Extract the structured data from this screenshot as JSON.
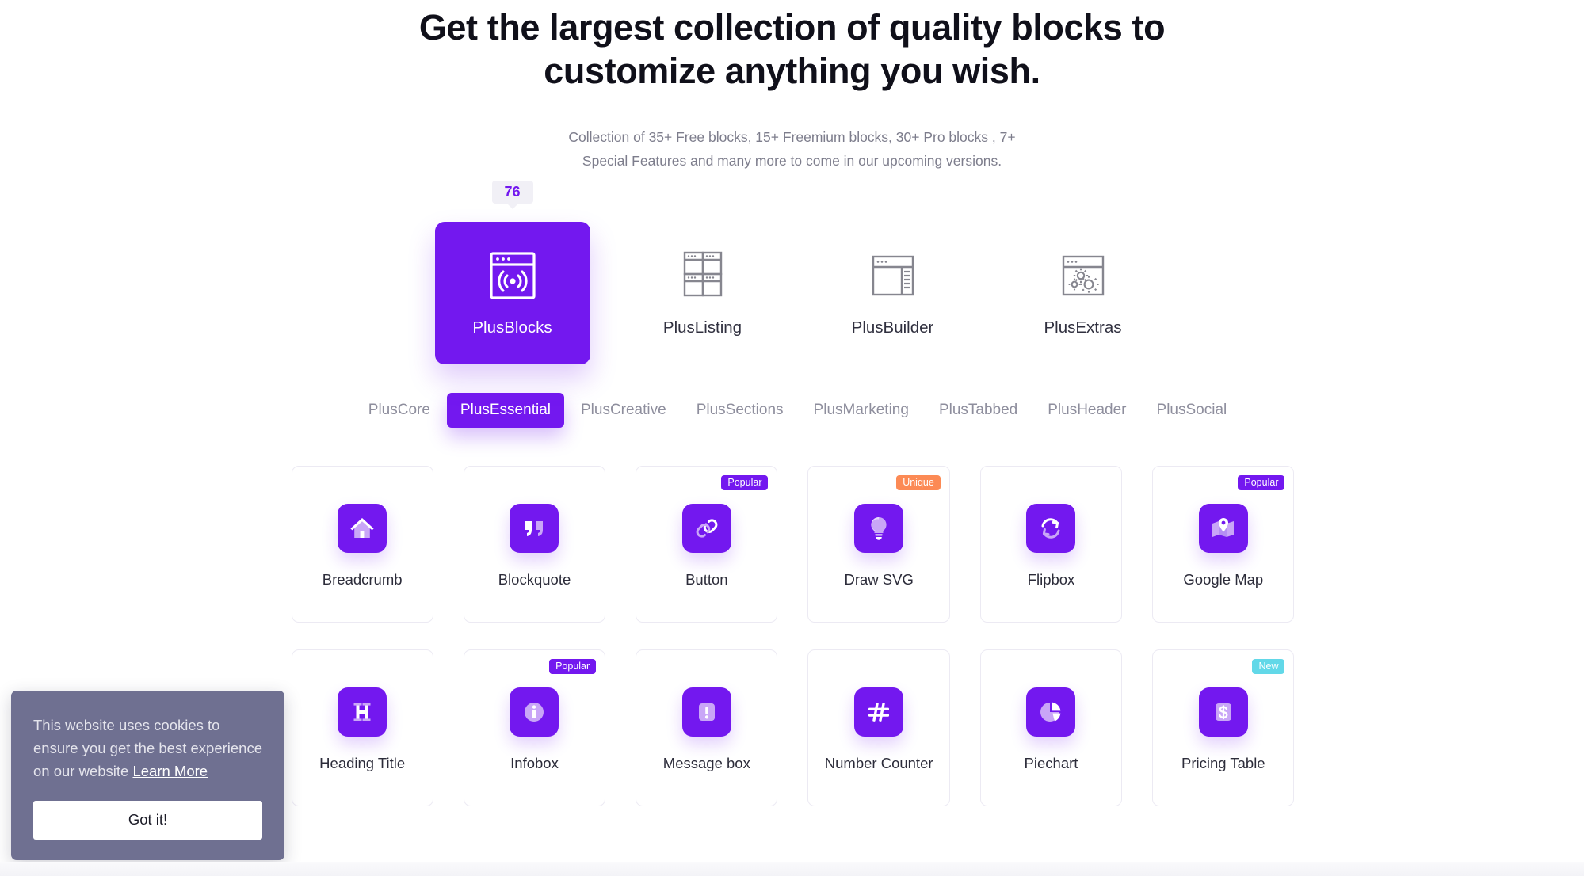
{
  "hero": {
    "title_line1": "Get the largest collection of quality blocks to",
    "title_line2": "customize anything you wish.",
    "sub_line1": "Collection of 35+ Free blocks, 15+ Freemium blocks, 30+ Pro blocks , 7+",
    "sub_line2": "Special Features and many more to come in our upcoming versions."
  },
  "categories": {
    "count_badge": "76",
    "items": [
      {
        "label": "PlusBlocks",
        "icon": "window-signal-icon",
        "active": true
      },
      {
        "label": "PlusListing",
        "icon": "grid-windows-icon",
        "active": false
      },
      {
        "label": "PlusBuilder",
        "icon": "window-sidebar-icon",
        "active": false
      },
      {
        "label": "PlusExtras",
        "icon": "window-gears-icon",
        "active": false
      }
    ]
  },
  "tabs": [
    {
      "label": "PlusCore",
      "active": false
    },
    {
      "label": "PlusEssential",
      "active": true
    },
    {
      "label": "PlusCreative",
      "active": false
    },
    {
      "label": "PlusSections",
      "active": false
    },
    {
      "label": "PlusMarketing",
      "active": false
    },
    {
      "label": "PlusTabbed",
      "active": false
    },
    {
      "label": "PlusHeader",
      "active": false
    },
    {
      "label": "PlusSocial",
      "active": false
    }
  ],
  "blocks": [
    {
      "label": "Breadcrumb",
      "icon": "home-icon",
      "badge": null,
      "badge_type": null
    },
    {
      "label": "Blockquote",
      "icon": "quote-icon",
      "badge": null,
      "badge_type": null
    },
    {
      "label": "Button",
      "icon": "link-icon",
      "badge": "Popular",
      "badge_type": "popular"
    },
    {
      "label": "Draw SVG",
      "icon": "lightbulb-icon",
      "badge": "Unique",
      "badge_type": "unique"
    },
    {
      "label": "Flipbox",
      "icon": "flip-arrows-icon",
      "badge": null,
      "badge_type": null
    },
    {
      "label": "Google Map",
      "icon": "map-pin-icon",
      "badge": "Popular",
      "badge_type": "popular"
    },
    {
      "label": "Heading Title",
      "icon": "heading-h-icon",
      "badge": null,
      "badge_type": null
    },
    {
      "label": "Infobox",
      "icon": "info-circle-icon",
      "badge": "Popular",
      "badge_type": "popular"
    },
    {
      "label": "Message box",
      "icon": "exclamation-icon",
      "badge": null,
      "badge_type": null
    },
    {
      "label": "Number Counter",
      "icon": "hash-icon",
      "badge": null,
      "badge_type": null
    },
    {
      "label": "Piechart",
      "icon": "pie-chart-icon",
      "badge": null,
      "badge_type": null
    },
    {
      "label": "Pricing Table",
      "icon": "dollar-icon",
      "badge": "New",
      "badge_type": "new"
    }
  ],
  "cookie": {
    "text_before": "This website uses cookies to ensure you get the best experience on our website ",
    "link_label": "Learn More",
    "button_label": "Got it!"
  },
  "colors": {
    "accent": "#7318ef",
    "badge_popular": "#7318ef",
    "badge_unique": "#fc8a55",
    "badge_new": "#62d8e8",
    "cookie_bg": "#6f7091"
  }
}
